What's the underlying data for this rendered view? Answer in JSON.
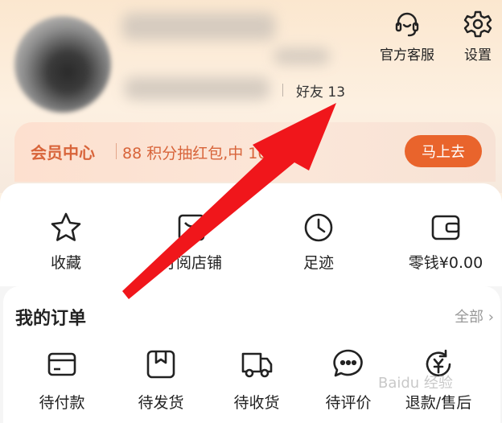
{
  "header": {
    "friends_label": "好友 13",
    "customer_service_label": "官方客服",
    "settings_label": "设置"
  },
  "vip": {
    "title": "会员中心",
    "promo_text": "88 积分抽红包,中    100%",
    "button_label": "马上去"
  },
  "quick_links": [
    {
      "label": "收藏",
      "icon": "star-icon"
    },
    {
      "label": "订阅店铺",
      "icon": "store-icon"
    },
    {
      "label": "足迹",
      "icon": "clock-icon"
    },
    {
      "label": "零钱¥0.00",
      "icon": "wallet-icon"
    }
  ],
  "orders": {
    "title": "我的订单",
    "all_label": "全部",
    "items": [
      {
        "label": "待付款",
        "icon": "card-icon"
      },
      {
        "label": "待发货",
        "icon": "box-icon"
      },
      {
        "label": "待收货",
        "icon": "truck-icon"
      },
      {
        "label": "待评价",
        "icon": "chat-icon"
      },
      {
        "label": "退款/售后",
        "icon": "refund-icon"
      }
    ]
  },
  "colors": {
    "accent": "#e9642c",
    "annotation_arrow": "#f0161b"
  }
}
